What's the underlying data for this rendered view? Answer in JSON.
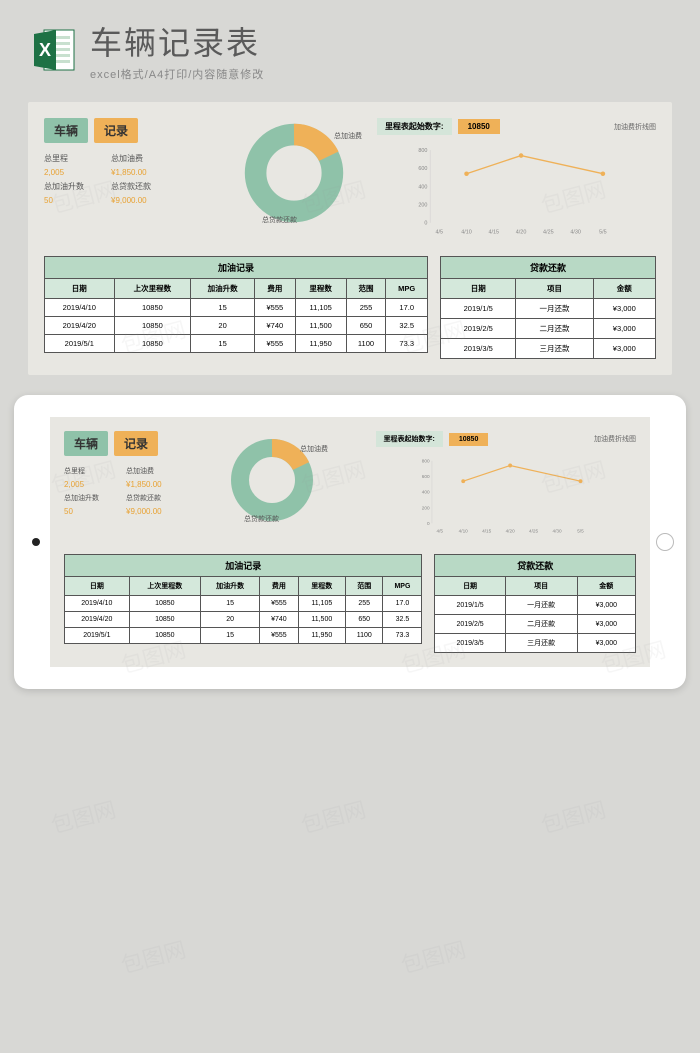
{
  "header": {
    "title": "车辆记录表",
    "subtitle": "excel格式/A4打印/内容随意修改"
  },
  "tags": {
    "vehicle": "车辆",
    "record": "记录"
  },
  "stats": {
    "total_mileage_label": "总里程",
    "total_mileage_value": "2,005",
    "total_fuel_cost_label": "总加油费",
    "total_fuel_cost_value": "¥1,850.00",
    "total_liters_label": "总加油升数",
    "total_liters_value": "50",
    "total_loan_label": "总贷款还款",
    "total_loan_value": "¥9,000.00"
  },
  "donut": {
    "label_fuel": "总加油费",
    "label_loan": "总贷款还款"
  },
  "odometer": {
    "label": "里程表起始数字:",
    "value": "10850",
    "chart_label": "加油费折线图"
  },
  "chart_data": {
    "type": "line",
    "x": [
      "4/5",
      "4/10",
      "4/15",
      "4/20",
      "4/25",
      "4/30",
      "5/5"
    ],
    "values": [
      null,
      555,
      null,
      740,
      null,
      null,
      555
    ],
    "ylim": [
      0,
      800
    ],
    "yticks": [
      0,
      200,
      400,
      600,
      800
    ],
    "title": "加油费折线图"
  },
  "fuel_table": {
    "title": "加油记录",
    "headers": [
      "日期",
      "上次里程数",
      "加油升数",
      "费用",
      "里程数",
      "范围",
      "MPG"
    ],
    "rows": [
      [
        "2019/4/10",
        "10850",
        "15",
        "¥555",
        "11,105",
        "255",
        "17.0"
      ],
      [
        "2019/4/20",
        "10850",
        "20",
        "¥740",
        "11,500",
        "650",
        "32.5"
      ],
      [
        "2019/5/1",
        "10850",
        "15",
        "¥555",
        "11,950",
        "1100",
        "73.3"
      ]
    ]
  },
  "loan_table": {
    "title": "贷款还款",
    "headers": [
      "日期",
      "项目",
      "金额"
    ],
    "rows": [
      [
        "2019/1/5",
        "一月还款",
        "¥3,000"
      ],
      [
        "2019/2/5",
        "二月还款",
        "¥3,000"
      ],
      [
        "2019/3/5",
        "三月还款",
        "¥3,000"
      ]
    ]
  },
  "watermark": "包图网"
}
